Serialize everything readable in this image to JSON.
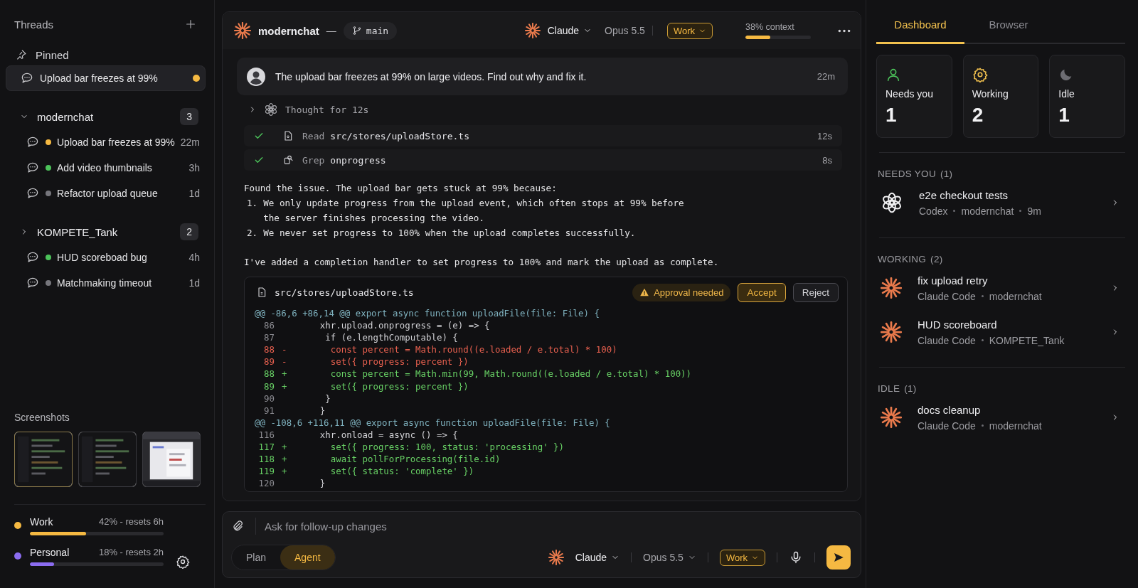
{
  "sidebar": {
    "title": "Threads",
    "pinned": {
      "label": "Pinned",
      "items": [
        {
          "title": "Upload bar freezes at 99%",
          "color": "#f5b942",
          "selected": true
        }
      ]
    },
    "projects": [
      {
        "name": "modernchat",
        "count": "3",
        "expanded": true,
        "threads": [
          {
            "title": "Upload bar freezes at 99%",
            "time": "22m",
            "color": "#f5b942"
          },
          {
            "title": "Add video thumbnails",
            "time": "3h",
            "color": "#4cc35a"
          },
          {
            "title": "Refactor upload queue",
            "time": "1d",
            "color": "#76767c"
          }
        ]
      },
      {
        "name": "KOMPETE_Tank",
        "count": "2",
        "expanded": false,
        "threads": [
          {
            "title": "HUD scoreboad bug",
            "time": "4h",
            "color": "#4cc35a"
          },
          {
            "title": "Matchmaking timeout",
            "time": "1d",
            "color": "#76767c"
          }
        ]
      }
    ],
    "screenshots": {
      "label": "Screenshots",
      "items": [
        {
          "kind": "picture",
          "selected": true
        },
        {
          "kind": "picture",
          "selected": false
        },
        {
          "kind": "picture",
          "selected": false
        }
      ]
    },
    "usage": [
      {
        "name": "Work",
        "reading": "42% - resets 6h",
        "level": 0.42,
        "color": "#f5b942"
      },
      {
        "name": "Personal",
        "reading": "18% - resets 2h",
        "level": 0.18,
        "color": "#8b6cf0"
      }
    ]
  },
  "chat": {
    "header": {
      "project": "modernchat",
      "separator": "—",
      "branch": "main",
      "agent": "Claude",
      "model": "Opus 5.5",
      "profile": "Work",
      "context": {
        "label": "38% context",
        "level": 0.38
      }
    },
    "user_message": {
      "text": "The upload bar freezes at 99% on large videos. Find out why and fix it.",
      "time": "22m"
    },
    "thought": {
      "label": "Thought for 12s",
      "expanded": false
    },
    "tools": [
      {
        "kind": "read",
        "verb": "Read",
        "arg": "src/stores/uploadStore.ts",
        "time": "12s",
        "done": true
      },
      {
        "kind": "grep",
        "verb": "Grep",
        "arg": "onprogress",
        "time": "8s",
        "done": true
      }
    ],
    "reply": {
      "intro": "Found the issue. The upload bar gets stuck at 99% because:",
      "list": [
        {
          "number": "1.",
          "text": "We only update progress from the upload event, which often stops at 99% before the server finishes processing the video."
        },
        {
          "number": "2.",
          "text": "We never set progress to 100% when the upload completes successfully."
        }
      ],
      "outro": "I've added a completion handler to set progress to 100% and mark the upload as complete."
    },
    "diff": {
      "file": "src/stores/uploadStore.ts",
      "status": "Approval needed",
      "actions": [
        {
          "label": "Accept",
          "kind": "primary"
        },
        {
          "label": "Reject",
          "kind": "secondary"
        }
      ],
      "lines": [
        {
          "kind": "hunk",
          "text": "@@ -86,6 +86,14 @@ export async function uploadFile(file: File) {"
        },
        {
          "kind": "context",
          "number": "86",
          "code": "    xhr.upload.onprogress = (e) => {"
        },
        {
          "kind": "context",
          "number": "87",
          "code": "     if (e.lengthComputable) {"
        },
        {
          "kind": "del",
          "number": "88",
          "sign": "-",
          "code": "      const percent = Math.round((e.loaded / e.total) * 100)"
        },
        {
          "kind": "del",
          "number": "89",
          "sign": "-",
          "code": "      set({ progress: percent })"
        },
        {
          "kind": "add",
          "number": "88",
          "sign": "+",
          "code": "      const percent = Math.min(99, Math.round((e.loaded / e.total) * 100))"
        },
        {
          "kind": "add",
          "number": "89",
          "sign": "+",
          "code": "      set({ progress: percent })"
        },
        {
          "kind": "context",
          "number": "90",
          "code": "     }"
        },
        {
          "kind": "context",
          "number": "91",
          "code": "    }"
        },
        {
          "kind": "hunk",
          "text": "@@ -108,6 +116,11 @@ export async function uploadFile(file: File) {"
        },
        {
          "kind": "context",
          "number": "116",
          "code": "    xhr.onload = async () => {"
        },
        {
          "kind": "add",
          "number": "117",
          "sign": "+",
          "code": "      set({ progress: 100, status: 'processing' })"
        },
        {
          "kind": "add",
          "number": "118",
          "sign": "+",
          "code": "      await pollForProcessing(file.id)"
        },
        {
          "kind": "add",
          "number": "119",
          "sign": "+",
          "code": "      set({ status: 'complete' })"
        },
        {
          "kind": "context",
          "number": "120",
          "code": "    }"
        }
      ]
    }
  },
  "composer": {
    "placeholder": "Ask for follow-up changes",
    "modes": [
      {
        "label": "Plan",
        "selected": false
      },
      {
        "label": "Agent",
        "selected": true
      }
    ],
    "agent": "Claude",
    "model": "Opus 5.5",
    "profile": "Work"
  },
  "dashboard": {
    "tabs": [
      {
        "label": "Dashboard",
        "selected": true
      },
      {
        "label": "Browser",
        "selected": false
      }
    ],
    "stats": [
      {
        "kind": "needs",
        "label": "Needs you",
        "value": "1"
      },
      {
        "kind": "working",
        "label": "Working",
        "value": "2"
      },
      {
        "kind": "idle",
        "label": "Idle",
        "value": "1"
      }
    ],
    "sections": [
      {
        "title": "NEEDS YOU",
        "count": "(1)",
        "items": [
          {
            "kind": "codex",
            "title": "e2e checkout tests",
            "meta": [
              "Codex",
              "modernchat",
              "9m"
            ]
          }
        ]
      },
      {
        "title": "WORKING",
        "count": "(2)",
        "items": [
          {
            "kind": "claude",
            "title": "fix upload retry",
            "meta": [
              "Claude Code",
              "modernchat"
            ]
          },
          {
            "kind": "claude",
            "title": "HUD scoreboard",
            "meta": [
              "Claude Code",
              "KOMPETE_Tank"
            ]
          }
        ]
      },
      {
        "title": "IDLE",
        "count": "(1)",
        "items": [
          {
            "kind": "claude",
            "title": "docs cleanup",
            "meta": [
              "Claude Code",
              "modernchat"
            ]
          }
        ]
      }
    ]
  }
}
